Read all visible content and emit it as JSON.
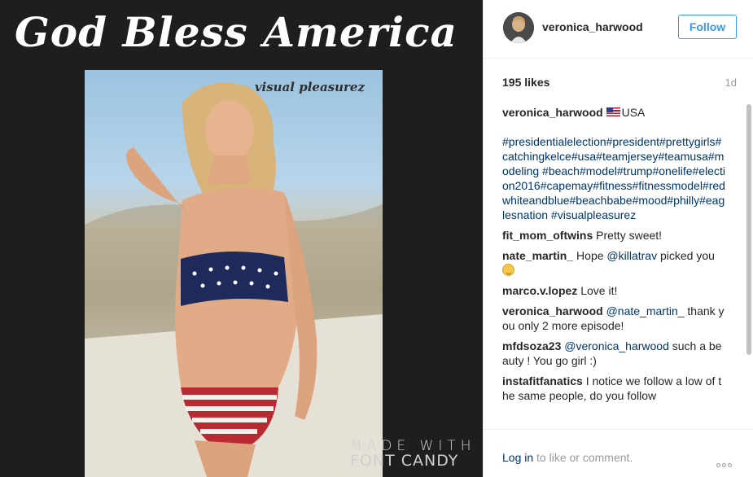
{
  "media": {
    "title": "God Bless America",
    "photo_watermark": "visual pleasurez",
    "made_with": "MADE WITH",
    "font_candy": "FONT CANDY"
  },
  "post": {
    "username": "veronica_harwood",
    "follow_label": "Follow",
    "likes": "195 likes",
    "time_ago": "1d",
    "caption_user": "veronica_harwood",
    "caption_text": "USA",
    "hashtags": "#presidentialelection#president#prettygirls#catchingkelce#usa#teamjersey#teamusa#modeling #beach#model#trump#onelife#election2016#capemay#fitness#fitnessmodel#redwhiteandblue#beachbabe#mood#philly#eaglesnation #visualpleasurez",
    "comments": [
      {
        "user": "fit_mom_oftwins",
        "mention": "",
        "text": "Pretty sweet!"
      },
      {
        "user": "nate_martin_",
        "mention": "",
        "text": "Hope",
        "mention_after": "@killatrav",
        "text_after": "picked you"
      },
      {
        "user": "marco.v.lopez",
        "mention": "",
        "text": "Love it!"
      },
      {
        "user": "veronica_harwood",
        "mention": "@nate_martin_",
        "text": "thank you only 2 more episode!"
      },
      {
        "user": "mfdsoza23",
        "mention": "@veronica_harwood",
        "text": "such a beauty ! You go girl :)"
      },
      {
        "user": "instafitfanatics",
        "mention": "",
        "text": "I notice we follow a low of the same people, do you follow"
      }
    ]
  },
  "footer": {
    "login_link": "Log in",
    "login_text": "to like or comment."
  },
  "colors": {
    "link": "#003569",
    "accent": "#3897f0",
    "muted": "#999999"
  },
  "icons": [
    "us-flag-icon",
    "winking-face-icon",
    "more-options-icon"
  ]
}
